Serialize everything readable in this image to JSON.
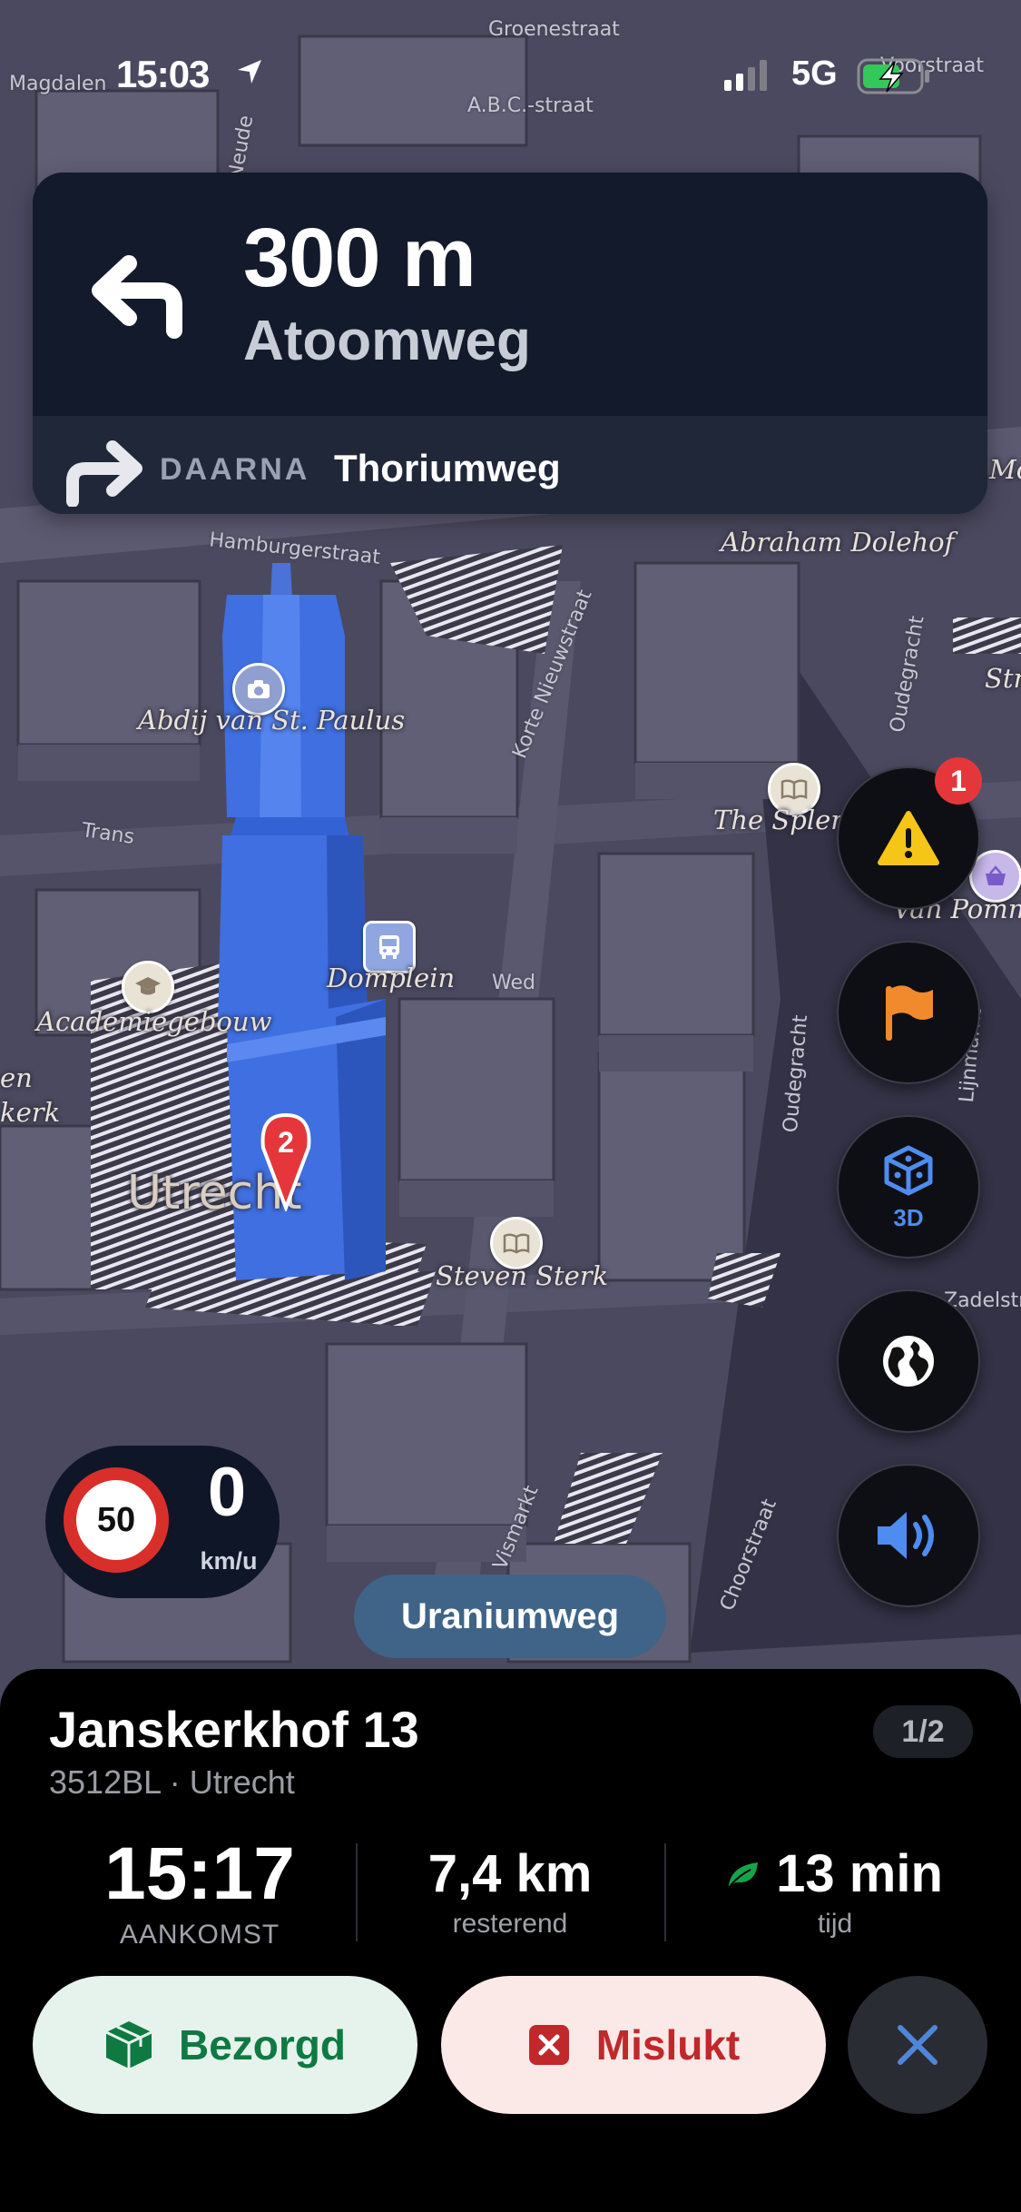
{
  "status_bar": {
    "time": "15:03",
    "network": "5G"
  },
  "navigation": {
    "distance": "300 m",
    "street": "Atoomweg",
    "then_label": "DAARNA",
    "then_street": "Thoriumweg"
  },
  "map": {
    "city_label": "Utrecht",
    "route_stop_number": "2",
    "pois": [
      {
        "name": "Abdij van St. Paulus",
        "icon": "camera-icon"
      },
      {
        "name": "The Splend",
        "icon": "book-icon"
      },
      {
        "name": "Van Pomm",
        "icon": "shopping-basket-icon"
      },
      {
        "name": "Domplein",
        "icon": "bus-icon"
      },
      {
        "name": "Academiegebouw",
        "icon": "graduation-cap-icon"
      },
      {
        "name": "Steven Sterk",
        "icon": "book-icon"
      },
      {
        "name": "Abraham Dolehof",
        "icon": ""
      }
    ],
    "street_labels": [
      "Groenestraat",
      "A.B.C.-straat",
      "Hamburgerstraat",
      "Korte Nieuwstraat",
      "Oudegracht",
      "Trans",
      "Wed",
      "Oudegracht",
      "Lijnmarkt",
      "Vismarkt",
      "Choorstraat",
      "Magdalen",
      "Neude",
      "Voorstraat",
      "Zadelstraat"
    ],
    "edge_labels": {
      "left_top": "en",
      "left_bottom": "kerk",
      "right_mo": "Mo",
      "right_str": "Stri"
    }
  },
  "map_controls": {
    "alerts_badge": "1",
    "view_3d_label": "3D"
  },
  "speed": {
    "limit": "50",
    "current": "0",
    "unit": "km/u"
  },
  "current_street": "Uraniumweg",
  "delivery": {
    "address": "Janskerkhof 13",
    "postal_city": "3512BL · Utrecht",
    "pager": "1/2",
    "arrival_time": "15:17",
    "arrival_label": "AANKOMST",
    "remaining_distance": "7,4 km",
    "remaining_label": "resterend",
    "duration": "13 min",
    "duration_label": "tijd",
    "delivered_label": "Bezorgd",
    "failed_label": "Mislukt"
  },
  "colors": {
    "success": "#0e7a42",
    "danger": "#c0282b",
    "accent": "#3f6487",
    "warning": "#f5c518",
    "flag": "#f08a2c"
  }
}
